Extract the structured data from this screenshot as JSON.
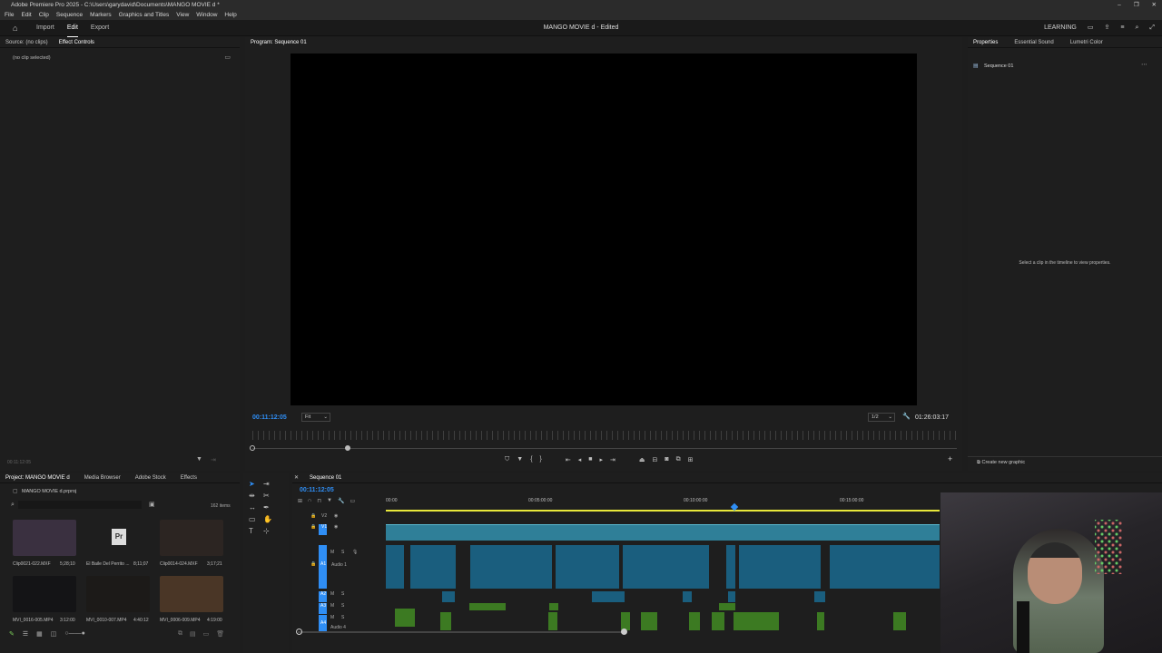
{
  "titlebar": {
    "text": "Adobe Premiere Pro 2025 - C:\\Users\\garydavid\\Documents\\MANGO MOVIE d *",
    "min": "–",
    "max": "❐",
    "close": "✕"
  },
  "menu": [
    "File",
    "Edit",
    "Clip",
    "Sequence",
    "Markers",
    "Graphics and Titles",
    "View",
    "Window",
    "Help"
  ],
  "workspace": {
    "tabs": [
      "Import",
      "Edit",
      "Export"
    ],
    "active": "Edit",
    "title": "MANGO MOVIE d - Edited",
    "learning": "LEARNING"
  },
  "source": {
    "tabs": [
      "Source: (no clips)",
      "Effect Controls"
    ],
    "active": "Effect Controls",
    "empty": "(no clip selected)",
    "footer_tc": "00:11:12:05"
  },
  "program": {
    "title": "Program: Sequence 01",
    "timecode": "00:11:12:05",
    "fit": "Fit",
    "resolution": "1/2",
    "duration": "01:26:03:17"
  },
  "properties": {
    "tabs": [
      "Properties",
      "Essential Sound",
      "Lumetri Color"
    ],
    "active": "Properties",
    "seq": "Sequence 01",
    "hint": "Select a clip in the timeline to view properties.",
    "create": "Create new graphic"
  },
  "project": {
    "tabs": [
      "Project: MANGO MOVIE d",
      "Media Browser",
      "Adobe Stock",
      "Effects"
    ],
    "active": "Project: MANGO MOVIE d",
    "path": "MANGO MOVIE d.prproj",
    "count": "162 items",
    "items": [
      {
        "name": "Clip0021-022.MXF",
        "dur": "5;28;10",
        "color": "#3a3040"
      },
      {
        "name": "El Baile Del Perrito ...",
        "dur": "8;11;07",
        "color": "#e8e8e8"
      },
      {
        "name": "Clip0014-024.MXF",
        "dur": "3;17;21",
        "color": "#2c2522"
      },
      {
        "name": "MVI_0016-005.MP4",
        "dur": "3:12:00",
        "color": "#141416"
      },
      {
        "name": "MVI_0010-007.MP4",
        "dur": "4:40:12",
        "color": "#1c1a18"
      },
      {
        "name": "MVI_0006-009.MP4",
        "dur": "4:19:00",
        "color": "#4a3626"
      }
    ]
  },
  "timeline": {
    "tab": "Sequence 01",
    "timecode": "00:11:12:05",
    "ruler": [
      "00:00",
      "00:05:00:00",
      "00:10:00:00",
      "00:15:00:00"
    ],
    "tracks": [
      "V2",
      "V1",
      "A1",
      "A2",
      "A3",
      "A4"
    ],
    "audio1_name": "Audio 1",
    "audio4_name": "Audio 4"
  },
  "colors": {
    "accent": "#2f8ef5",
    "video_clip": "#2f7f98",
    "audio_clip": "#1a5e7e",
    "music_clip": "#3c7a22"
  }
}
